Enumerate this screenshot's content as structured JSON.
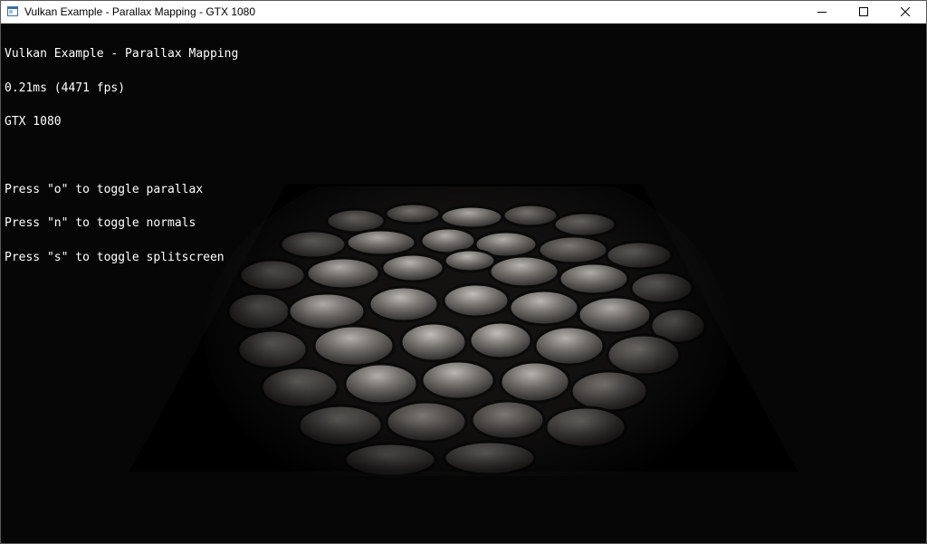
{
  "window": {
    "title": "Vulkan Example - Parallax Mapping - GTX 1080",
    "icons": {
      "app": "app-window-icon",
      "minimize": "minimize-icon",
      "maximize": "maximize-icon",
      "close": "close-icon"
    }
  },
  "overlay": {
    "title": "Vulkan Example - Parallax Mapping",
    "frame_time": "0.21ms (4471 fps)",
    "device": "GTX 1080",
    "help": [
      "Press \"o\" to toggle parallax",
      "Press \"n\" to toggle normals",
      "Press \"s\" to toggle splitscreen"
    ]
  },
  "colors": {
    "background": "#060606",
    "plane": "#000000",
    "stone": "#4a4a48",
    "overlay_text": "#ffffff"
  }
}
